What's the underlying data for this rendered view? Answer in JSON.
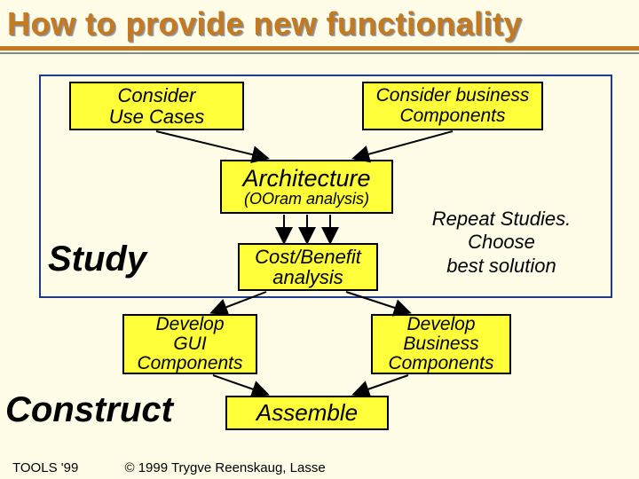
{
  "title": "How to provide new functionality",
  "boxes": {
    "usecases_l1": "Consider",
    "usecases_l2": "Use Cases",
    "business_l1": "Consider business",
    "business_l2": "Components",
    "arch_main": "Architecture",
    "arch_sub": "(OOram analysis)",
    "cost_l1": "Cost/Benefit",
    "cost_l2": "analysis",
    "gui_l1": "Develop",
    "gui_l2": "GUI",
    "gui_l3": "Components",
    "devbus_l1": "Develop",
    "devbus_l2": "Business",
    "devbus_l3": "Components",
    "assemble": "Assemble"
  },
  "labels": {
    "study": "Study",
    "construct": "Construct"
  },
  "right": {
    "line1": "Repeat Studies.",
    "line2": "Choose",
    "line3": "best solution"
  },
  "footer": {
    "left": "TOOLS '99",
    "copy": "© 1999 Trygve Reenskaug, Lasse"
  }
}
